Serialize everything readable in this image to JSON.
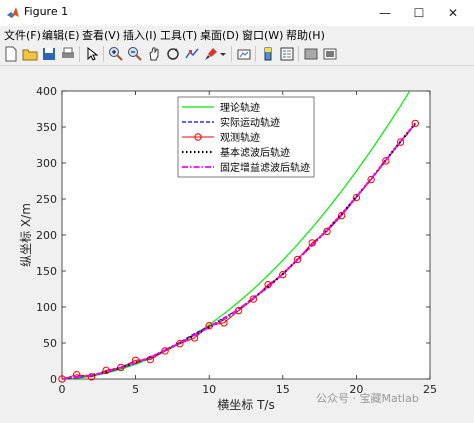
{
  "window": {
    "title": "Figure 1",
    "minimize": "—",
    "maximize": "☐",
    "close": "✕"
  },
  "menu": [
    "文件(F)",
    "编辑(E)",
    "查看(V)",
    "插入(I)",
    "工具(T)",
    "桌面(D)",
    "窗口(W)",
    "帮助(H)"
  ],
  "toolbar": {
    "icons": [
      "new-figure-icon",
      "open-file-icon",
      "save-icon",
      "print-icon",
      "pointer-icon",
      "zoom-in-icon",
      "zoom-out-icon",
      "pan-icon",
      "rotate-3d-icon",
      "data-cursor-icon",
      "brush-icon",
      "link-plot-icon",
      "colorbar-icon",
      "legend-icon",
      "hide-plot-tools-icon",
      "show-plot-tools-icon"
    ]
  },
  "chart_data": {
    "type": "line",
    "title": "",
    "xlabel": "横坐标 T/s",
    "ylabel": "纵坐标 X/m",
    "xlim": [
      0,
      25
    ],
    "ylim": [
      0,
      400
    ],
    "xticks": [
      "0",
      "5",
      "10",
      "15",
      "20",
      "25"
    ],
    "yticks": [
      "0",
      "50",
      "100",
      "150",
      "200",
      "250",
      "300",
      "350",
      "400"
    ],
    "grid": false,
    "legend_position": "top-center",
    "series": [
      {
        "name": "理论轨迹",
        "color": "#00ee00",
        "style": "solid",
        "x": [
          0,
          1,
          2,
          3,
          4,
          5,
          6,
          7,
          8,
          9,
          10,
          11,
          12,
          13,
          14,
          15,
          16,
          17,
          18,
          19,
          20,
          21,
          22,
          23,
          24
        ],
        "y": [
          0,
          1.3,
          4,
          8.1,
          13.6,
          20.4,
          28.7,
          38.3,
          49.3,
          61.6,
          75.4,
          90.5,
          107,
          124.9,
          144.2,
          164.8,
          186.8,
          210.2,
          235,
          261.2,
          288.7,
          317.6,
          347.9,
          379.5,
          412.6
        ]
      },
      {
        "name": "实际运动轨迹",
        "color": "#0000ff",
        "style": "dashed",
        "x": [
          0,
          1,
          2,
          3,
          4,
          5,
          6,
          7,
          8,
          9,
          10,
          11,
          12,
          13,
          14,
          15,
          16,
          17,
          18,
          19,
          20,
          21,
          22,
          23,
          24
        ],
        "y": [
          0,
          2,
          5,
          9,
          15,
          22,
          30,
          40,
          51,
          63,
          73,
          85,
          97,
          113,
          128,
          146,
          165,
          186,
          207,
          229,
          253,
          277,
          304,
          329,
          354
        ]
      },
      {
        "name": "观测轨迹",
        "color": "#ff0000",
        "style": "solid-circle",
        "x": [
          0,
          1,
          2,
          3,
          4,
          5,
          6,
          7,
          8,
          9,
          10,
          11,
          12,
          13,
          14,
          15,
          16,
          17,
          18,
          19,
          20,
          21,
          22,
          23,
          24
        ],
        "y": [
          0,
          6,
          3,
          12,
          16,
          26,
          27,
          39,
          49,
          57,
          74,
          78,
          95,
          111,
          131,
          145,
          166,
          189,
          205,
          227,
          252,
          277,
          303,
          329,
          355
        ]
      },
      {
        "name": "基本滤波后轨迹",
        "color": "#000000",
        "style": "dotted",
        "x": [
          0,
          1,
          2,
          3,
          4,
          5,
          6,
          7,
          8,
          9,
          10,
          11,
          12,
          13,
          14,
          15,
          16,
          17,
          18,
          19,
          20,
          21,
          22,
          23,
          24
        ],
        "y": [
          0,
          3,
          5,
          10,
          16,
          23,
          30,
          40,
          50,
          61,
          72,
          83,
          97,
          112,
          128,
          146,
          166,
          186,
          207,
          229,
          253,
          278,
          304,
          330,
          355
        ]
      },
      {
        "name": "固定增益滤波后轨迹",
        "color": "#ff00ff",
        "style": "dashdot",
        "x": [
          0,
          1,
          2,
          3,
          4,
          5,
          6,
          7,
          8,
          9,
          10,
          11,
          12,
          13,
          14,
          15,
          16,
          17,
          18,
          19,
          20,
          21,
          22,
          23,
          24
        ],
        "y": [
          0,
          3,
          5,
          10,
          16,
          23,
          30,
          40,
          50,
          61,
          72,
          84,
          97,
          112,
          128,
          146,
          166,
          186,
          207,
          229,
          253,
          278,
          304,
          330,
          355
        ]
      }
    ]
  },
  "watermark": "公众号 · 宝藏Matlab"
}
